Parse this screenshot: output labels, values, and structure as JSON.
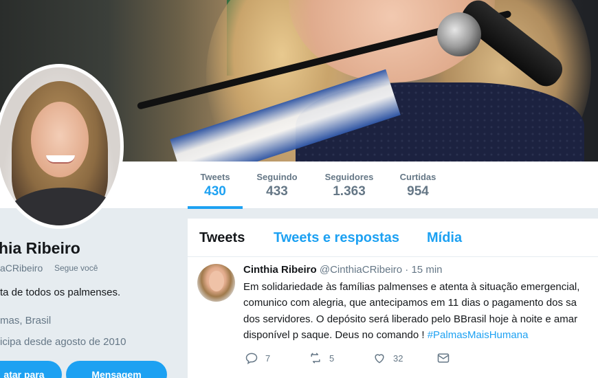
{
  "stats": [
    {
      "label": "Tweets",
      "value": "430"
    },
    {
      "label": "Seguindo",
      "value": "433"
    },
    {
      "label": "Seguidores",
      "value": "1.363"
    },
    {
      "label": "Curtidas",
      "value": "954"
    }
  ],
  "profile": {
    "name": "hia Ribeiro",
    "handle": "aCRibeiro",
    "follows_you": "Segue você",
    "bio": "ta de todos os palmenses.",
    "location": "mas, Brasil",
    "joined": "icipa desde agosto de 2010",
    "tweet_button": "atar para",
    "message_button": "Mensagem"
  },
  "tabs": [
    "Tweets",
    "Tweets e respostas",
    "Mídia"
  ],
  "tweet": {
    "name": "Cinthia Ribeiro",
    "handle": "@CinthiaCRibeiro",
    "separator": "·",
    "time": "15 min",
    "lines": [
      "Em solidariedade às famílias palmenses e atenta à situação emergencial,",
      "comunico com alegria, que antecipamos em 11 dias o pagamento dos sa",
      "dos servidores. O depósito será liberado pelo BBrasil hoje à noite e amar",
      "disponível p saque. Deus no comando !"
    ],
    "hashtag": "#PalmasMaisHumana",
    "replies": "7",
    "retweets": "5",
    "likes": "32"
  },
  "colors": {
    "accent": "#1da1f2",
    "muted": "#657786",
    "background": "#e6ecf0"
  }
}
